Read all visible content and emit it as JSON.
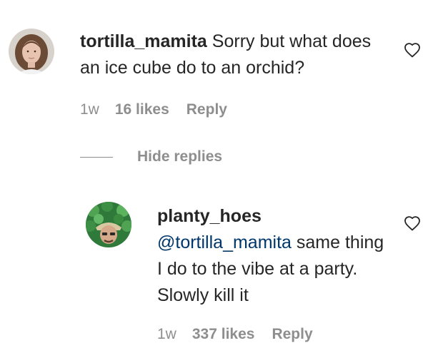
{
  "comment": {
    "username": "tortilla_mamita",
    "text": "Sorry but what does an ice cube do to an orchid?",
    "time": "1w",
    "likes": "16 likes",
    "reply_label": "Reply"
  },
  "hide_replies_label": "Hide replies",
  "reply": {
    "username": "planty_hoes",
    "mention": "@tortilla_mamita",
    "text": "same thing I do to the vibe at a party. Slowly kill it",
    "time": "1w",
    "likes": "337 likes",
    "reply_label": "Reply"
  },
  "icons": {
    "like": "heart-icon"
  },
  "colors": {
    "text": "#262626",
    "muted": "#8e8e8e",
    "mention": "#00376b"
  }
}
